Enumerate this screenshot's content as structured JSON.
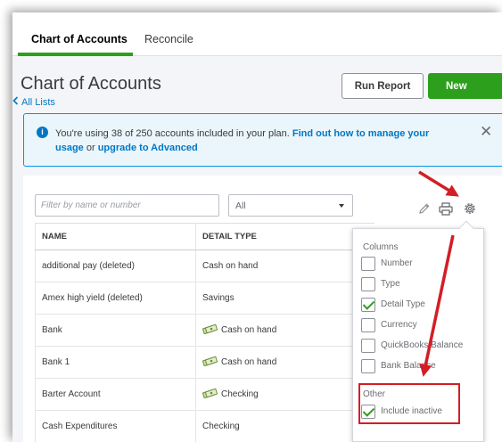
{
  "tabs": [
    {
      "label": "Chart of Accounts",
      "active": true
    },
    {
      "label": "Reconcile",
      "active": false
    }
  ],
  "header": {
    "title": "Chart of Accounts",
    "back_link": "All Lists",
    "run_report_label": "Run Report",
    "new_label": "New"
  },
  "banner": {
    "text": "You're using 38 of 250 accounts included in your plan.",
    "link1": "Find out how to manage your usage",
    "or_text": "or",
    "link2": "upgrade to Advanced"
  },
  "filters": {
    "search_placeholder": "Filter by name or number",
    "type_value": "All"
  },
  "table": {
    "columns": [
      "NAME",
      "DETAIL TYPE"
    ],
    "rows": [
      {
        "name": "additional pay (deleted)",
        "detail": "Cash on hand",
        "money_icon": false
      },
      {
        "name": "Amex high yield (deleted)",
        "detail": "Savings",
        "money_icon": false
      },
      {
        "name": "Bank",
        "detail": "Cash on hand",
        "money_icon": true
      },
      {
        "name": "Bank 1",
        "detail": "Cash on hand",
        "money_icon": true
      },
      {
        "name": "Barter Account",
        "detail": "Checking",
        "money_icon": true
      },
      {
        "name": "Cash Expenditures",
        "detail": "Checking",
        "money_icon": false
      }
    ]
  },
  "settings_popup": {
    "columns_heading": "Columns",
    "columns": [
      {
        "label": "Number",
        "checked": false
      },
      {
        "label": "Type",
        "checked": false
      },
      {
        "label": "Detail Type",
        "checked": true
      },
      {
        "label": "Currency",
        "checked": false
      },
      {
        "label": "QuickBooks Balance",
        "checked": false
      },
      {
        "label": "Bank Balance",
        "checked": false
      }
    ],
    "other_heading": "Other",
    "other": [
      {
        "label": "Include inactive",
        "checked": true
      }
    ]
  },
  "icons": {
    "edit": "pencil-icon",
    "print": "printer-icon",
    "settings": "gear-icon",
    "info": "info-icon",
    "close": "close-icon",
    "back": "chevron-left-icon",
    "money": "money-icon"
  },
  "colors": {
    "brand_green": "#2ca01c",
    "link_blue": "#0077c5",
    "annotation_red": "#d21e26",
    "banner_bg": "#eaf6fb"
  }
}
